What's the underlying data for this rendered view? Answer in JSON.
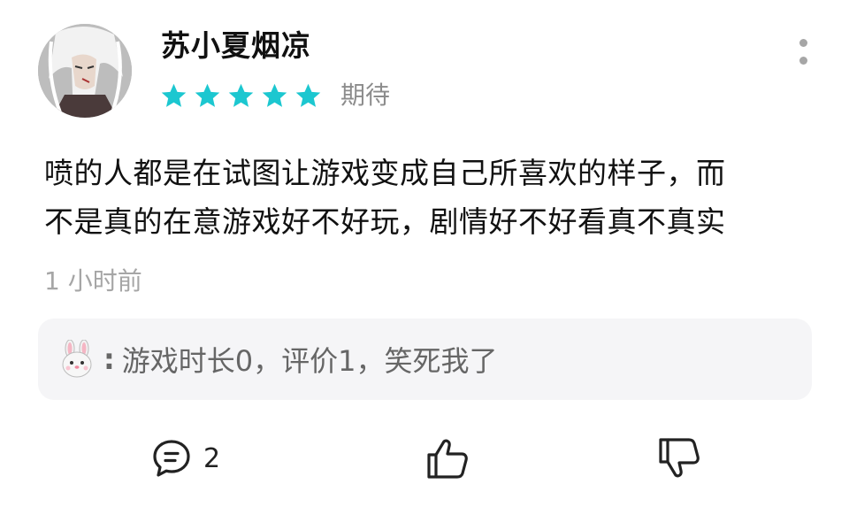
{
  "user": {
    "name": "苏小夏烟凉",
    "avatar_icon": "avatar-icon"
  },
  "rating": {
    "stars": 5,
    "max": 5,
    "star_color": "#1cc7d0",
    "label": "期待"
  },
  "comment": {
    "lines": [
      "喷的人都是在试图让游戏变成自己所喜欢的样子，而",
      "不是真的在意游戏好不好玩，剧情好不好看真不真实"
    ],
    "time": "1 小时前"
  },
  "reply": {
    "avatar_icon": "rabbit-icon",
    "separator": ":",
    "text": "游戏时长0，评价1，笑死我了"
  },
  "actions": {
    "comment_icon": "comment-icon",
    "comment_count": "2",
    "like_icon": "thumbs-up-icon",
    "dislike_icon": "thumbs-down-icon",
    "more_icon": "more-vertical-icon"
  }
}
